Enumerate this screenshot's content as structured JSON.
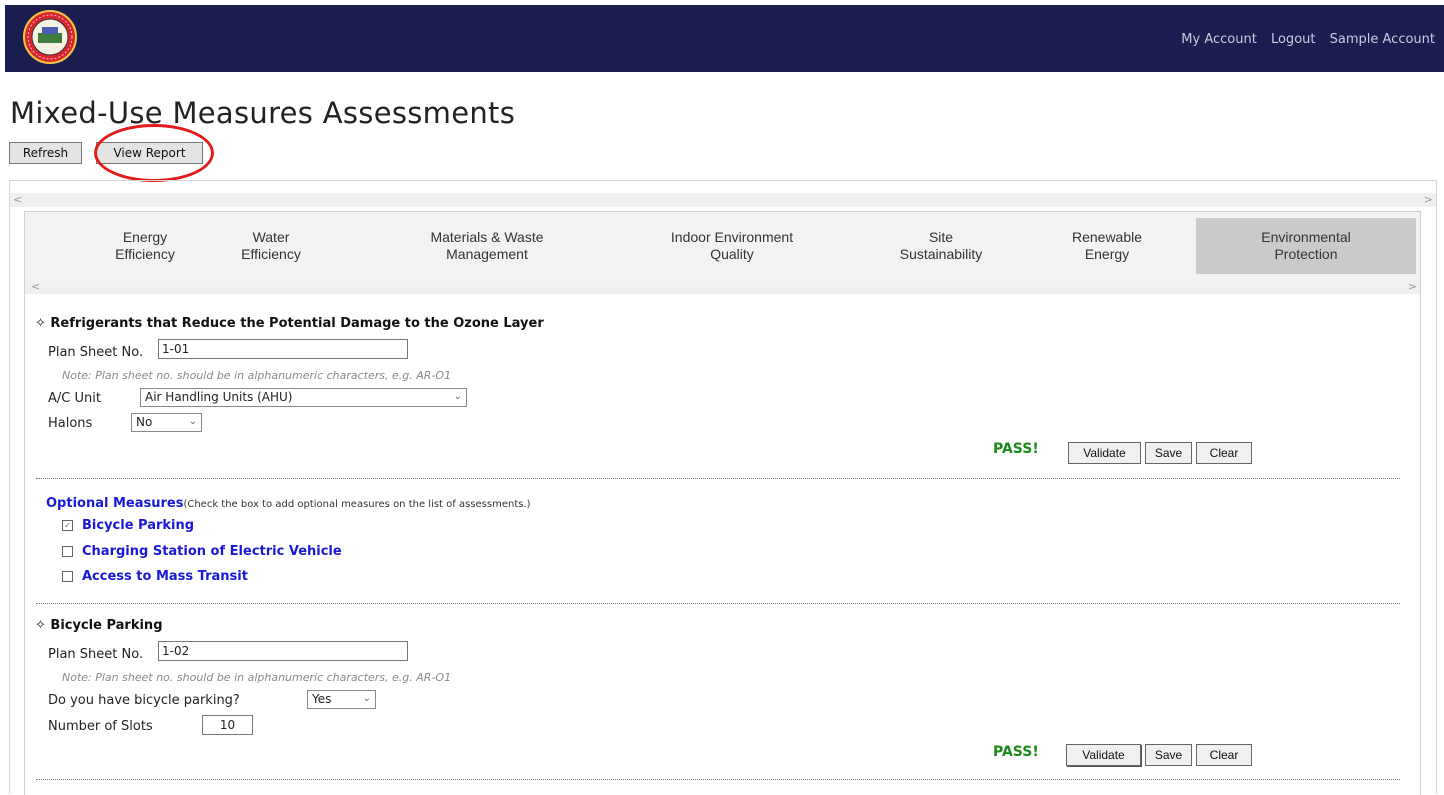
{
  "header": {
    "links": [
      "My Account",
      "Logout",
      "Sample Account"
    ]
  },
  "page": {
    "title": "Mixed-Use Measures Assessments",
    "refresh_label": "Refresh",
    "view_report_label": "View Report"
  },
  "tabs": [
    {
      "label": "Energy\nEfficiency",
      "active": false
    },
    {
      "label": "Water\nEfficiency",
      "active": false
    },
    {
      "label": "Materials & Waste\nManagement",
      "active": false
    },
    {
      "label": "Indoor Environment\nQuality",
      "active": false
    },
    {
      "label": "Site\nSustainability",
      "active": false
    },
    {
      "label": "Renewable\nEnergy",
      "active": false
    },
    {
      "label": "Environmental\nProtection",
      "active": true
    }
  ],
  "section1": {
    "title": "Refrigerants that Reduce the Potential Damage to the Ozone Layer",
    "plan_sheet_label": "Plan Sheet No.",
    "plan_sheet_value": "1-01",
    "note": "Note: Plan sheet no. should be in alphanumeric characters, e.g. AR-O1",
    "ac_unit_label": "A/C Unit",
    "ac_unit_value": "Air Handling Units (AHU)",
    "halons_label": "Halons",
    "halons_value": "No",
    "status": "PASS!",
    "validate_label": "Validate",
    "save_label": "Save",
    "clear_label": "Clear"
  },
  "optional": {
    "title": "Optional Measures",
    "description": "(Check the box to add optional measures on the list of assessments.)",
    "items": [
      {
        "label": "Bicycle Parking",
        "checked": true
      },
      {
        "label": "Charging Station of Electric Vehicle",
        "checked": false
      },
      {
        "label": "Access to Mass Transit",
        "checked": false
      }
    ]
  },
  "section2": {
    "title": "Bicycle Parking",
    "plan_sheet_label": "Plan Sheet No.",
    "plan_sheet_value": "1-02",
    "note": "Note: Plan sheet no. should be in alphanumeric characters, e.g. AR-O1",
    "has_parking_label": "Do you have bicycle parking?",
    "has_parking_value": "Yes",
    "slots_label": "Number of Slots",
    "slots_value": "10",
    "status": "PASS!",
    "validate_label": "Validate",
    "save_label": "Save",
    "clear_label": "Clear"
  },
  "colors": {
    "header_bg": "#1b1d4f",
    "pass": "#1b8a1b",
    "optional_link": "#1a1ad6",
    "highlight_circle": "#e31b1b",
    "active_tab": "#cacaca"
  }
}
